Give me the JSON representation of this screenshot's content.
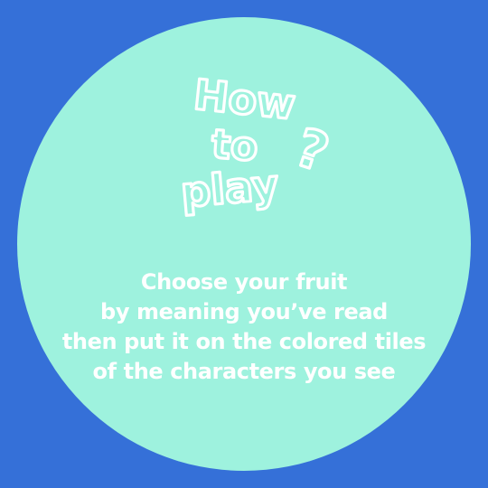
{
  "title": {
    "word1": "How",
    "word2": "to",
    "word3": "play",
    "mark": "?"
  },
  "instructions": [
    "Choose your fruit",
    "by meaning you’ve read",
    "then put it on the colored tiles",
    "of the characters you see"
  ],
  "colors": {
    "background": "#3570d8",
    "panel": "#9ef2de",
    "text": "#ffffff"
  }
}
